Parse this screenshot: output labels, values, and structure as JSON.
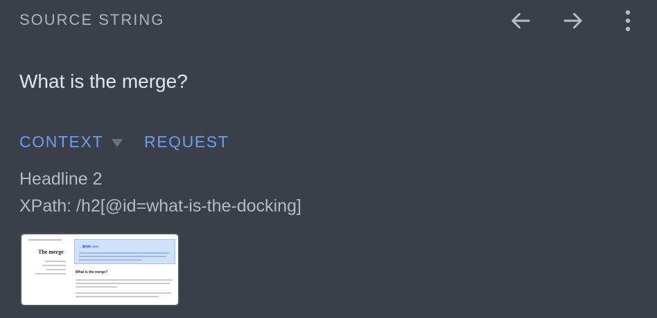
{
  "header": {
    "label": "SOURCE STRING",
    "back_icon": "arrow-left-icon",
    "forward_icon": "arrow-right-icon",
    "more_icon": "more-vertical-icon"
  },
  "source": {
    "text": "What is the merge?"
  },
  "tabs": [
    {
      "label": "CONTEXT",
      "active": true
    },
    {
      "label": "REQUEST",
      "active": false
    }
  ],
  "context": {
    "heading_type": "Headline 2",
    "xpath": "XPath: /h2[@id=what-is-the-docking]"
  },
  "screenshot": {
    "page_title": "The merge",
    "banner_title": "→ 翻译新 /ABB",
    "section_heading": "What is the merge?"
  },
  "colors": {
    "background": "#3a3f4a",
    "accent": "#6d9ef2",
    "header_text": "#aeb4bf",
    "primary_text": "#e4e6ea",
    "secondary_text": "#b6bac2"
  }
}
